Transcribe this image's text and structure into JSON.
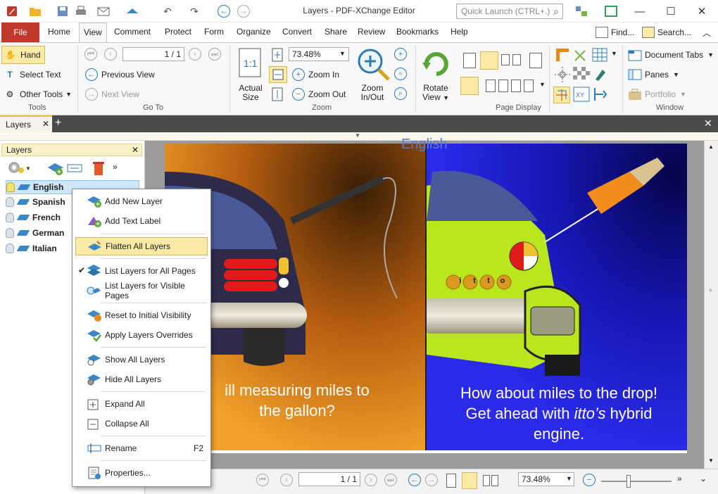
{
  "titlebar": {
    "title": "Layers - PDF-XChange Editor",
    "quick_launch_placeholder": "Quick Launch (CTRL+.)"
  },
  "tabs": {
    "file": "File",
    "items": [
      "Home",
      "View",
      "Comment",
      "Protect",
      "Form",
      "Organize",
      "Convert",
      "Share",
      "Review",
      "Bookmarks",
      "Help"
    ],
    "find": "Find...",
    "search": "Search..."
  },
  "ribbon": {
    "tools": {
      "hand": "Hand",
      "select_text": "Select Text",
      "other_tools": "Other Tools",
      "group": "Tools"
    },
    "goto": {
      "page_value": "1 / 1",
      "previous_view": "Previous View",
      "next_view": "Next View",
      "group": "Go To"
    },
    "zoom": {
      "actual_size_1": "Actual",
      "actual_size_2": "Size",
      "zoom_value": "73.48%",
      "zoom_in": "Zoom In",
      "zoom_out": "Zoom Out",
      "zoom_inout_1": "Zoom",
      "zoom_inout_2": "In/Out",
      "group": "Zoom"
    },
    "rotate": {
      "label_1": "Rotate",
      "label_2": "View"
    },
    "page_display": {
      "group": "Page Display"
    },
    "window": {
      "document_tabs": "Document Tabs",
      "panes": "Panes",
      "portfolio": "Portfolio",
      "group": "Window"
    }
  },
  "doc_tab": {
    "label": "Layers"
  },
  "layers_panel": {
    "title": "Layers",
    "layers": [
      "English",
      "Spanish",
      "French",
      "German",
      "Italian"
    ]
  },
  "context_menu": {
    "items": [
      {
        "label": "Add New Layer"
      },
      {
        "label": "Add Text Label"
      },
      {
        "label": "Flatten All Layers"
      },
      {
        "label": "List Layers for All Pages"
      },
      {
        "label": "List Layers for Visible Pages"
      },
      {
        "label": "Reset to Initial Visibility"
      },
      {
        "label": "Apply Layers Overrides"
      },
      {
        "label": "Show All Layers"
      },
      {
        "label": "Hide All Layers"
      },
      {
        "label": "Expand All"
      },
      {
        "label": "Collapse All"
      },
      {
        "label": "Rename",
        "shortcut": "F2"
      },
      {
        "label": "Properties..."
      }
    ]
  },
  "document": {
    "left_caption_1": "ill measuring miles to",
    "left_caption_2": "the gallon?",
    "right_caption_1": "How about miles to the drop!",
    "right_caption_2a": "Get ahead with ",
    "right_caption_2b": "itto’s",
    "right_caption_2c": " hybrid",
    "right_caption_3": "engine.",
    "top_text": "English",
    "badge_letters": [
      "i",
      "t",
      "t",
      "o"
    ]
  },
  "statusbar": {
    "page_value": "1 / 1",
    "zoom_value": "73.48%"
  },
  "colors": {
    "file_tab": "#c0392b",
    "accent_blue": "#2d7ab5",
    "highlight": "#fbe9a6",
    "left_bg": "#e8881a",
    "right_bg": "#1c1cd0"
  }
}
